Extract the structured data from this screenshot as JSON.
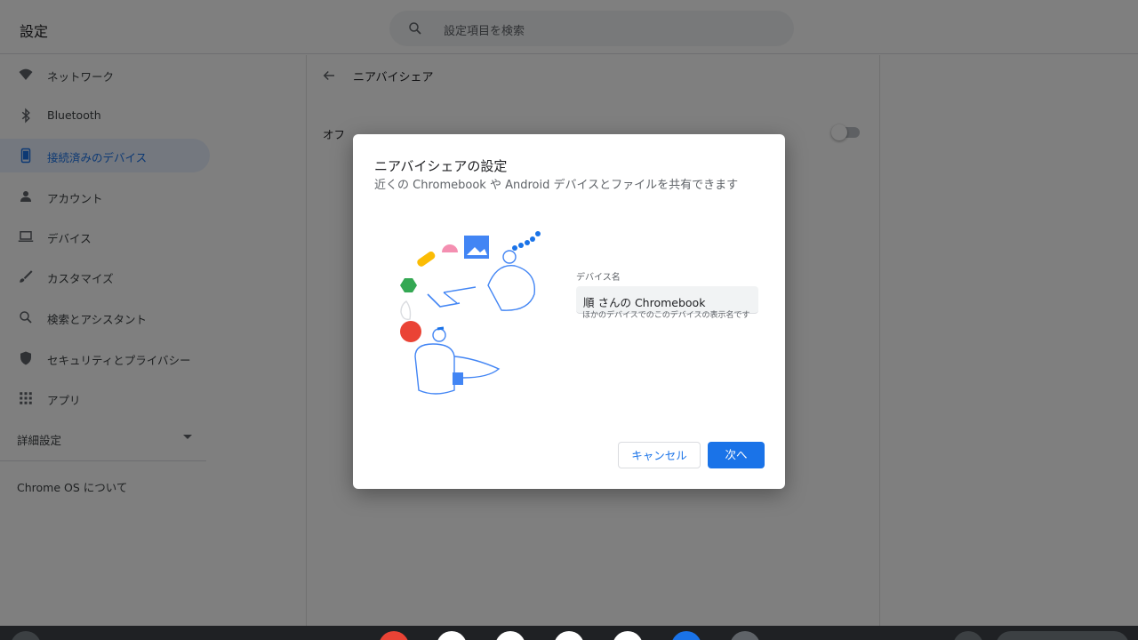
{
  "app": {
    "title": "設定"
  },
  "search": {
    "placeholder": "設定項目を検索",
    "icon": "search-icon"
  },
  "sidebar": {
    "items": [
      {
        "label": "ネットワーク",
        "icon": "wifi-icon"
      },
      {
        "label": "Bluetooth",
        "icon": "bluetooth-icon"
      },
      {
        "label": "接続済みのデバイス",
        "icon": "phone-icon",
        "active": true
      },
      {
        "label": "アカウント",
        "icon": "person-icon"
      },
      {
        "label": "デバイス",
        "icon": "laptop-icon"
      },
      {
        "label": "カスタマイズ",
        "icon": "brush-icon"
      },
      {
        "label": "検索とアシスタント",
        "icon": "search-icon"
      },
      {
        "label": "セキュリティとプライバシー",
        "icon": "shield-icon"
      },
      {
        "label": "アプリ",
        "icon": "apps-grid-icon"
      }
    ],
    "advanced": "詳細設定",
    "about": "Chrome OS について"
  },
  "content": {
    "title": "ニアバイシェア",
    "off_label": "オフ",
    "toggle_on": false
  },
  "dialog": {
    "title": "ニアバイシェアの設定",
    "subtitle": "近くの Chromebook や Android デバイスとファイルを共有できます",
    "field_label": "デバイス名",
    "field_value": "順 さんの Chromebook",
    "field_hint": "ほかのデバイスでのこのデバイスの表示名です",
    "cancel": "キャンセル",
    "next": "次へ"
  },
  "colors": {
    "accent": "#1a73e8",
    "active_bg": "#e8f0fe",
    "scrim": "rgba(0,0,0,0.5)"
  }
}
